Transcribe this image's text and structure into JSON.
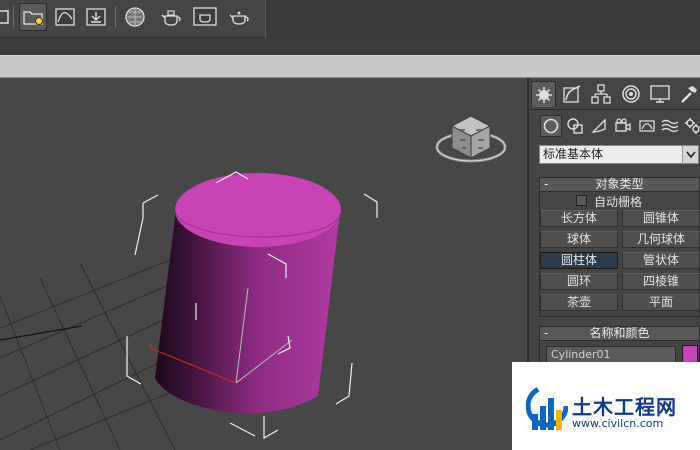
{
  "toolbar": {
    "icons": [
      "render-frame-icon",
      "render-setup-icon",
      "curve-editor-icon",
      "rendered-frame-window-icon",
      "material-editor-icon",
      "teapot-render-icon",
      "teapot-active-icon",
      "teapot-iterative-icon"
    ]
  },
  "viewport": {
    "object_color": "#c843b4"
  },
  "command_panel": {
    "tabs": [
      "create-tab",
      "modify-tab",
      "hierarchy-tab",
      "motion-tab",
      "display-tab",
      "utilities-tab"
    ],
    "categories": [
      "geometry",
      "shapes",
      "lights",
      "cameras",
      "helpers",
      "space-warps",
      "systems"
    ],
    "dropdown_value": "标准基本体",
    "object_type": {
      "title": "对象类型",
      "collapse_symbol": "-",
      "autogrid_label": "自动栅格",
      "buttons": [
        "长方体",
        "圆锥体",
        "球体",
        "几何球体",
        "圆柱体",
        "管状体",
        "圆环",
        "四棱锥",
        "茶壶",
        "平面"
      ],
      "active": "圆柱体"
    },
    "name_color": {
      "title": "名称和颜色",
      "collapse_symbol": "-",
      "name": "Cylinder01",
      "color": "#c843b4"
    }
  },
  "watermark": {
    "title": "土木工程网",
    "url": "www.civilcn.com"
  }
}
